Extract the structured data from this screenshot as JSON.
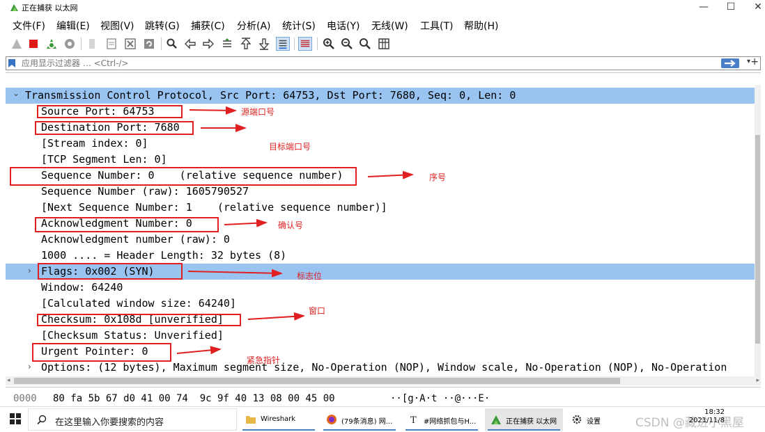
{
  "window": {
    "title": "正在捕获 以太网",
    "minimize_glyph": "—",
    "maximize_glyph": "☐",
    "close_glyph": "✕"
  },
  "menu": [
    "文件(F)",
    "编辑(E)",
    "视图(V)",
    "跳转(G)",
    "捕获(C)",
    "分析(A)",
    "统计(S)",
    "电话(Y)",
    "无线(W)",
    "工具(T)",
    "帮助(H)"
  ],
  "toolbar_icons": [
    "shark-fin-start-icon",
    "stop-capture-icon",
    "restart-capture-icon",
    "capture-options-icon",
    "open-file-icon",
    "save-file-icon",
    "close-file-icon",
    "reload-file-icon",
    "find-packet-icon",
    "go-back-icon",
    "go-forward-icon",
    "go-to-packet-icon",
    "first-packet-icon",
    "last-packet-icon",
    "auto-scroll-icon",
    "colorize-icon",
    "zoom-in-icon",
    "zoom-out-icon",
    "normal-size-icon",
    "resize-columns-icon"
  ],
  "filter": {
    "placeholder": "应用显示过滤器 … <Ctrl-/>",
    "dropdown_glyph": "▾",
    "add_glyph": "+"
  },
  "packet_details": {
    "rows": [
      {
        "text": "Transmission Control Protocol, Src Port: 64753, Dst Port: 7680, Seq: 0, Len: 0",
        "expander": "⌄",
        "selected": true
      },
      {
        "text": "Source Port: 64753"
      },
      {
        "text": "Destination Port: 7680"
      },
      {
        "text": "[Stream index: 0]"
      },
      {
        "text": "[TCP Segment Len: 0]"
      },
      {
        "text": "Sequence Number: 0    (relative sequence number)"
      },
      {
        "text": "Sequence Number (raw): 1605790527"
      },
      {
        "text": "[Next Sequence Number: 1    (relative sequence number)]"
      },
      {
        "text": "Acknowledgment Number: 0"
      },
      {
        "text": "Acknowledgment number (raw): 0"
      },
      {
        "text": "1000 .... = Header Length: 32 bytes (8)"
      },
      {
        "text": "Flags: 0x002 (SYN)",
        "expander": "›",
        "selected": true
      },
      {
        "text": "Window: 64240"
      },
      {
        "text": "[Calculated window size: 64240]"
      },
      {
        "text": "Checksum: 0x108d [unverified]"
      },
      {
        "text": "[Checksum Status: Unverified]"
      },
      {
        "text": "Urgent Pointer: 0"
      },
      {
        "text": "Options: (12 bytes), Maximum segment size, No-Operation (NOP), Window scale, No-Operation (NOP), No-Operation",
        "expander": "›"
      }
    ]
  },
  "annotations": [
    "源端口号",
    "目标端口号",
    "序号",
    "确认号",
    "标志位",
    "窗口",
    "紧急指针"
  ],
  "bytes": {
    "offset": "0000",
    "hex": "80 fa 5b 67 d0 41 00 74  9c 9f 40 13 08 00 45 00",
    "ascii": "··[g·A·t ··@···E·"
  },
  "scroll": {
    "left_glyph": "◂",
    "right_glyph": "▸"
  },
  "taskbar": {
    "search_placeholder": "在这里输入你要搜索的内容",
    "tasks": [
      {
        "label": "Wireshark",
        "icon": "folder-icon"
      },
      {
        "label": "(79条消息) 网...",
        "icon": "firefox-icon"
      },
      {
        "label": "#网络抓包与H...",
        "icon": "typora-icon"
      },
      {
        "label": "正在捕获 以太网",
        "icon": "wireshark-icon",
        "active": true
      },
      {
        "label": "设置",
        "icon": "settings-icon"
      }
    ],
    "time": "18:32",
    "date": "2021/11/8",
    "watermark": "CSDN @藏进小黑屋"
  }
}
